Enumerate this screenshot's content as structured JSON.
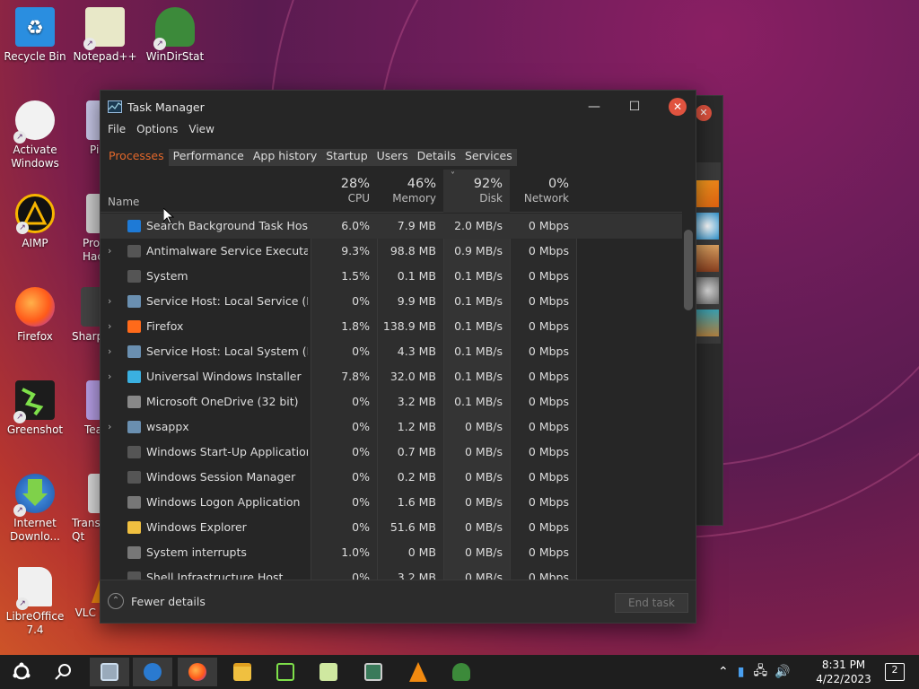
{
  "desktop": {
    "icons": [
      {
        "label": "Recycle Bin",
        "color": "#2a8ee0"
      },
      {
        "label": "Notepad++",
        "color": "#8ac04a"
      },
      {
        "label": "WinDirStat",
        "color": "#3c8a3a"
      },
      {
        "label": "Activate Windows",
        "color": "#dcdcdc"
      },
      {
        "label": "AIMP",
        "color": "#f7b500"
      },
      {
        "label": "Firefox",
        "color": "#ff6a1a"
      },
      {
        "label": "Greenshot",
        "color": "#2e8a2e"
      },
      {
        "label": "Internet Downlo...",
        "color": "#1d6bd1"
      },
      {
        "label": "LibreOffice 7.4",
        "color": "#f0f0f0"
      }
    ],
    "partial_icons": [
      {
        "label": "Pi"
      },
      {
        "label": "Pro Hac"
      },
      {
        "label": "Sharp"
      },
      {
        "label": "Tea"
      },
      {
        "label": "Trans Qt"
      },
      {
        "label": "VLC player"
      }
    ]
  },
  "taskmanager": {
    "title": "Task Manager",
    "menu": [
      "File",
      "Options",
      "View"
    ],
    "tabs": [
      "Processes",
      "Performance",
      "App history",
      "Startup",
      "Users",
      "Details",
      "Services"
    ],
    "columns": {
      "name": "Name",
      "cpu": {
        "pct": "28%",
        "label": "CPU"
      },
      "memory": {
        "pct": "46%",
        "label": "Memory"
      },
      "disk": {
        "pct": "92%",
        "label": "Disk"
      },
      "network": {
        "pct": "0%",
        "label": "Network"
      }
    },
    "processes": [
      {
        "name": "Search Background Task Host",
        "cpu": "6.0%",
        "mem": "7.9 MB",
        "disk": "2.0 MB/s",
        "net": "0 Mbps",
        "expand": false,
        "icon": "search-icon",
        "color": "#1e7ad6"
      },
      {
        "name": "Antimalware Service Executa...",
        "cpu": "9.3%",
        "mem": "98.8 MB",
        "disk": "0.9 MB/s",
        "net": "0 Mbps",
        "expand": true,
        "icon": "process-icon",
        "color": "#555"
      },
      {
        "name": "System",
        "cpu": "1.5%",
        "mem": "0.1 MB",
        "disk": "0.1 MB/s",
        "net": "0 Mbps",
        "expand": false,
        "icon": "process-icon",
        "color": "#555"
      },
      {
        "name": "Service Host: Local Service (N...",
        "cpu": "0%",
        "mem": "9.9 MB",
        "disk": "0.1 MB/s",
        "net": "0 Mbps",
        "expand": true,
        "icon": "gear-icon",
        "color": "#6a8fb0"
      },
      {
        "name": "Firefox",
        "cpu": "1.8%",
        "mem": "138.9 MB",
        "disk": "0.1 MB/s",
        "net": "0 Mbps",
        "expand": true,
        "icon": "firefox-icon",
        "color": "#ff6a1a"
      },
      {
        "name": "Service Host: Local System (N...",
        "cpu": "0%",
        "mem": "4.3 MB",
        "disk": "0.1 MB/s",
        "net": "0 Mbps",
        "expand": true,
        "icon": "gear-icon",
        "color": "#6a8fb0"
      },
      {
        "name": "Universal Windows Installer",
        "cpu": "7.8%",
        "mem": "32.0 MB",
        "disk": "0.1 MB/s",
        "net": "0 Mbps",
        "expand": true,
        "icon": "installer-icon",
        "color": "#3ab0e0"
      },
      {
        "name": "Microsoft OneDrive (32 bit)",
        "cpu": "0%",
        "mem": "3.2 MB",
        "disk": "0.1 MB/s",
        "net": "0 Mbps",
        "expand": false,
        "icon": "cloud-icon",
        "color": "#888"
      },
      {
        "name": "wsappx",
        "cpu": "0%",
        "mem": "1.2 MB",
        "disk": "0 MB/s",
        "net": "0 Mbps",
        "expand": true,
        "icon": "gear-icon",
        "color": "#6a8fb0"
      },
      {
        "name": "Windows Start-Up Application",
        "cpu": "0%",
        "mem": "0.7 MB",
        "disk": "0 MB/s",
        "net": "0 Mbps",
        "expand": false,
        "icon": "process-icon",
        "color": "#555"
      },
      {
        "name": "Windows Session Manager",
        "cpu": "0%",
        "mem": "0.2 MB",
        "disk": "0 MB/s",
        "net": "0 Mbps",
        "expand": false,
        "icon": "process-icon",
        "color": "#555"
      },
      {
        "name": "Windows Logon Application",
        "cpu": "0%",
        "mem": "1.6 MB",
        "disk": "0 MB/s",
        "net": "0 Mbps",
        "expand": false,
        "icon": "window-icon",
        "color": "#777"
      },
      {
        "name": "Windows Explorer",
        "cpu": "0%",
        "mem": "51.6 MB",
        "disk": "0 MB/s",
        "net": "0 Mbps",
        "expand": false,
        "icon": "folder-icon",
        "color": "#f0c040"
      },
      {
        "name": "System interrupts",
        "cpu": "1.0%",
        "mem": "0 MB",
        "disk": "0 MB/s",
        "net": "0 Mbps",
        "expand": false,
        "icon": "window-icon",
        "color": "#777"
      },
      {
        "name": "Shell Infrastructure Host",
        "cpu": "0%",
        "mem": "3.2 MB",
        "disk": "0 MB/s",
        "net": "0 Mbps",
        "expand": false,
        "icon": "process-icon",
        "color": "#555"
      }
    ],
    "fewer_details": "Fewer details",
    "end_task": "End task"
  },
  "taskbar": {
    "clock_time": "8:31 PM",
    "clock_date": "4/22/2023",
    "notifications": "2"
  }
}
